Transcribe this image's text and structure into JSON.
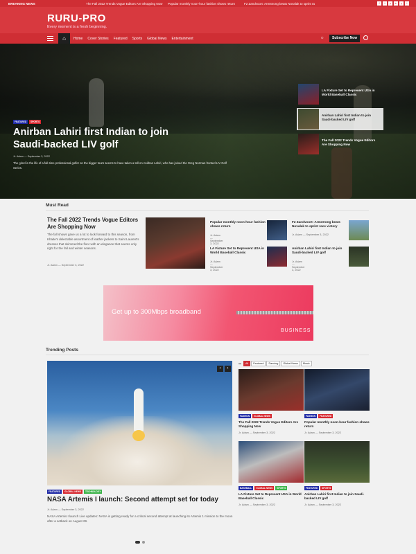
{
  "topbar": {
    "breaking_label": "BREAKING NEWS",
    "ticker": [
      "The Fall 2022 Trends Vogue Editors Are Shopping Now",
      "Popular monthly noon-hour fashion shows return",
      "F2 Zandvoort: Armstrong beats Novalak to sprint ra"
    ],
    "social": [
      "f",
      "t",
      "p",
      "in",
      "y",
      "i"
    ]
  },
  "brand": {
    "logo": "RURU-PRO",
    "tagline": "Every moment is a fresh beginning."
  },
  "nav": {
    "home_icon": "home-icon",
    "items": [
      "Home",
      "Cover Stories",
      "Featured",
      "Sports",
      "Global News",
      "Entertainment"
    ],
    "subscribe": "Subscribe Now"
  },
  "hero": {
    "tags": [
      "FEATURED",
      "SPORTS"
    ],
    "title": "Anirban Lahiri first Indian to join Saudi-backed LIV golf",
    "meta": "Jr. Adam  —  September 3, 2022",
    "excerpt": "The grind in the life of a full-time professional golfer on the bigger tours seems to have taken a toll on Anirban Lahiri, who has joined the Greg Norman-fronted LIV Golf Series.",
    "side": [
      {
        "title": "LA Fixture Set to Represent USA in World Baseball Classic"
      },
      {
        "title": "Anirban Lahiri first Indian to join Saudi-backed LIV golf"
      },
      {
        "title": "The Fall 2022 Trends Vogue Editors Are Shopping Now"
      }
    ]
  },
  "must_read": {
    "heading": "Must Read",
    "main": {
      "title": "The Fall 2022 Trends Vogue Editors Are Shopping Now",
      "excerpt": "The fall shows gave us a lot to look forward to this season, from Khaite's delectable assortment of leather jackets to Saint Laurent's dresses that skimmed the floor with an elegance that seems only right for the fall and winter seasons.",
      "meta": "Jr. Adam  —  September 3, 2022"
    },
    "items": [
      {
        "title": "Popular monthly noon-hour fashion shows return",
        "meta": "Jr. Adam  —  September 3, 2022"
      },
      {
        "title": "F2 Zandvoort: Armstrong beats Novalak to sprint race victory",
        "meta": "Jr. Adam  —  September 3, 2022"
      },
      {
        "title": "LA Fixture Set to Represent USA in World Baseball Classic",
        "meta": "Jr. Adam  —  September 3, 2022"
      },
      {
        "title": "Anirban Lahiri first Indian to join Saudi-backed LIV golf",
        "meta": "Jr. Adam  —  September 3, 2022"
      }
    ]
  },
  "ad": {
    "headline": "Get up to 300Mbps broadband",
    "brand": "BUSINESS"
  },
  "trending": {
    "heading": "Trending Posts",
    "main": {
      "tags": [
        "FEATURED",
        "GLOBAL NEWS",
        "TECHNOLOGY"
      ],
      "title": "NASA Artemis I launch: Second attempt set for today",
      "meta": "Jr. Adam  —  September 3, 2022",
      "excerpt": "NASA Artemis I launch Live updates: NASA is getting ready for a critical second attempt at launching its Artemis 1 mission to the moon after a setback on August 29."
    },
    "tabs": [
      "All",
      "Featured",
      "Dancing",
      "Global News",
      "Music"
    ],
    "grid": [
      {
        "tags": [
          "FASHION",
          "GLOBAL NEWS"
        ],
        "title": "The Fall 2022 Trends Vogue Editors Are Shopping Now",
        "meta": "Jr. Adam  —  September 3, 2022"
      },
      {
        "tags": [
          "FASHION",
          "FEATURED"
        ],
        "title": "Popular monthly noon-hour fashion shows return",
        "meta": "Jr. Adam  —  September 3, 2022"
      },
      {
        "tags": [
          "BASEBALL",
          "GLOBAL NEWS",
          "SPORTS"
        ],
        "title": "LA Fixture Set to Represent USA in World Baseball Classic",
        "meta": "Jr. Adam  —  September 3, 2022"
      },
      {
        "tags": [
          "FEATURED",
          "SPORTS"
        ],
        "title": "Anirban Lahiri first Indian to join Saudi-backed LIV golf",
        "meta": "Jr. Adam  —  September 3, 2022"
      }
    ]
  },
  "colors": {
    "brand_red": "#cf2e34",
    "featured_tag": "#1f2aa6",
    "sports_tag": "#d6272f",
    "tech_tag": "#3cb44a"
  }
}
